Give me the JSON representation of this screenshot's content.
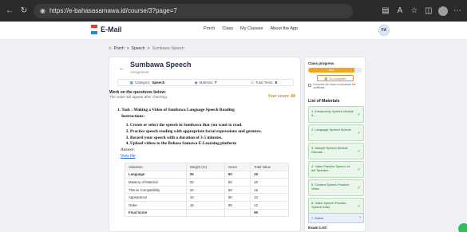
{
  "browser": {
    "url": "https://e-bahasasamawa.id/course/3?page=7",
    "icons": [
      "back-arrow-icon",
      "reload-icon",
      "lock-icon",
      "reader-icon",
      "translate-icon",
      "favorite-icon",
      "split-icon",
      "profile-icon",
      "more-icon"
    ]
  },
  "header": {
    "brand": "E-Mail",
    "nav": [
      "Porch",
      "Class",
      "My Classes",
      "About the App"
    ],
    "user_initials": "FA"
  },
  "breadcrumb": [
    "Porch",
    "Speech",
    "Sumbawa Speech"
  ],
  "assignment": {
    "title": "Sumbawa Speech",
    "subtitle": "Assignment",
    "category_label": "Category:",
    "category_value": "Speech",
    "material_label": "Material:",
    "material_value": "7",
    "total_tests_label": "Total Tests:",
    "total_tests_value": "8",
    "work_title": "Work on the questions below:",
    "work_sub": "The value will appear after checking.",
    "score": "Your score: 88"
  },
  "task": {
    "heading": "1.  Task : Making a Video of Sumbawa Language Speech Reading",
    "instructions": "Instructions:",
    "steps": [
      "Create or select the speech in Sumbawa that you want to read.",
      "Practice speech reading with appropriate facial expressions and gestures.",
      "Record your speech with a duration of 3-5 minutes.",
      "Upload videos to the Bahasa Samawa E-Learning platform"
    ],
    "answer_label": "Answer:",
    "view_file": "View file"
  },
  "score_table": {
    "headers": [
      "Valuation",
      "Weight (%)",
      "Score",
      "Total Value"
    ],
    "rows": [
      [
        "Language",
        "25",
        "80",
        "20"
      ],
      [
        "Mastery of Material",
        "25",
        "80",
        "20"
      ],
      [
        "Theme Compatibility",
        "20",
        "80",
        "16"
      ],
      [
        "Appearance",
        "15",
        "80",
        "12"
      ],
      [
        "Order",
        "15",
        "80",
        "12"
      ]
    ],
    "final": [
      "Final Score",
      "",
      "",
      "80"
    ]
  },
  "sidebar": {
    "progress_title": "Class progress",
    "progress_value": 0.86,
    "progress_label": "86%",
    "exam_button": "Do program",
    "exam_note": "Complete the class to download the certificate.",
    "materials_title": "List of Materials",
    "materials": [
      "1. Introductory Speech Module &...",
      "2. Language Speech Module ...",
      "3. Sample Speech Module Discuss...",
      "4. Video Practice Speech of the Speaker...",
      "5. Content Speech Practice Video",
      "6. Video Speech Practice Speech Artist",
      "7. Duties"
    ],
    "exam_list": "Exam List:"
  },
  "colors": {
    "accent_orange": "#f3a624",
    "green": "#2a8a3a",
    "blue": "#2b6fd1",
    "nav_dark": "#1d2a44"
  }
}
